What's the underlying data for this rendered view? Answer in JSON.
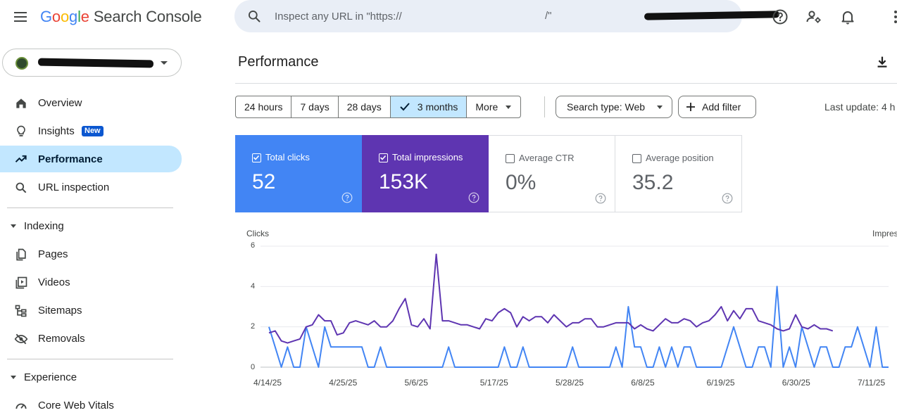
{
  "header": {
    "logo_letters": [
      "G",
      "o",
      "o",
      "g",
      "l",
      "e"
    ],
    "product": "Search Console",
    "search_placeholder": "Inspect any URL in \"https://",
    "search_suffix": "/\""
  },
  "sidebar": {
    "items": [
      {
        "label": "Overview",
        "icon": "home-icon"
      },
      {
        "label": "Insights",
        "icon": "lightbulb-icon",
        "badge": "New"
      },
      {
        "label": "Performance",
        "icon": "trending-up-icon",
        "active": true
      },
      {
        "label": "URL inspection",
        "icon": "search-icon"
      }
    ],
    "indexing": {
      "title": "Indexing",
      "items": [
        {
          "label": "Pages",
          "icon": "pages-icon"
        },
        {
          "label": "Videos",
          "icon": "video-icon"
        },
        {
          "label": "Sitemaps",
          "icon": "sitemap-icon"
        },
        {
          "label": "Removals",
          "icon": "removals-icon"
        }
      ]
    },
    "experience": {
      "title": "Experience",
      "items": [
        {
          "label": "Core Web Vitals",
          "icon": "gauge-icon"
        }
      ]
    }
  },
  "main": {
    "title": "Performance",
    "date_ranges": [
      "24 hours",
      "7 days",
      "28 days",
      "3 months",
      "More"
    ],
    "selected_range": "3 months",
    "search_type": "Search type: Web",
    "add_filter": "Add filter",
    "last_update": "Last update: 4 h",
    "metrics": [
      {
        "label": "Total clicks",
        "value": "52",
        "checked": true,
        "color": "#4285f4"
      },
      {
        "label": "Total impressions",
        "value": "153K",
        "checked": true,
        "color": "#5e35b1"
      },
      {
        "label": "Average CTR",
        "value": "0%",
        "checked": false
      },
      {
        "label": "Average position",
        "value": "35.2",
        "checked": false
      }
    ]
  },
  "chart_data": {
    "type": "line",
    "ylabel_left": "Clicks",
    "ylabel_right": "Impres",
    "yticks": [
      "6",
      "4",
      "2",
      "0"
    ],
    "ylim": [
      0,
      6
    ],
    "x_labels": [
      "4/14/25",
      "4/25/25",
      "5/6/25",
      "5/17/25",
      "5/28/25",
      "6/8/25",
      "6/19/25",
      "6/30/25",
      "7/11/25"
    ],
    "x_label_days": [
      0,
      11,
      22,
      33,
      44,
      55,
      66,
      77,
      88
    ],
    "series": [
      {
        "name": "Total clicks",
        "color": "#4285f4",
        "values": [
          2,
          1,
          0,
          1,
          0,
          0,
          2,
          1,
          0,
          2,
          1,
          1,
          1,
          1,
          1,
          1,
          0,
          0,
          1,
          0,
          0,
          0,
          0,
          0,
          0,
          0,
          0,
          0,
          0,
          1,
          0,
          0,
          0,
          0,
          0,
          0,
          0,
          0,
          1,
          0,
          0,
          1,
          0,
          0,
          0,
          0,
          0,
          0,
          0,
          1,
          0,
          0,
          0,
          0,
          0,
          0,
          1,
          0,
          3,
          1,
          1,
          0,
          0,
          1,
          0,
          1,
          0,
          1,
          1,
          0,
          0,
          0,
          0,
          0,
          1,
          2,
          1,
          0,
          0,
          1,
          1,
          0,
          4,
          0,
          1,
          0,
          2,
          1,
          0,
          1,
          1,
          0,
          0,
          1,
          1,
          2,
          1,
          0,
          2,
          0,
          0
        ]
      },
      {
        "name": "Total impressions",
        "color": "#5e35b1",
        "values": [
          1.7,
          1.8,
          1.3,
          1.2,
          1.3,
          1.4,
          2.0,
          2.1,
          2.6,
          2.3,
          2.3,
          1.6,
          1.7,
          2.2,
          2.3,
          2.2,
          2.1,
          2.3,
          2.0,
          2.0,
          2.3,
          2.9,
          3.4,
          2.1,
          2.0,
          2.4,
          1.9,
          5.6,
          2.3,
          2.3,
          2.2,
          2.1,
          2.1,
          2.0,
          1.9,
          2.4,
          2.3,
          2.7,
          2.9,
          2.7,
          2.0,
          2.5,
          2.3,
          2.5,
          2.5,
          2.2,
          2.6,
          2.3,
          2.0,
          2.2,
          2.2,
          2.4,
          2.4,
          2.0,
          2.0,
          2.1,
          2.2,
          2.2,
          2.2,
          1.9,
          2.1,
          1.9,
          1.8,
          2.1,
          2.4,
          2.2,
          2.2,
          2.4,
          2.3,
          2.0,
          2.2,
          2.3,
          2.6,
          3.0,
          2.3,
          2.8,
          2.4,
          2.9,
          2.9,
          2.3,
          2.2,
          2.1,
          1.9,
          1.8,
          1.9,
          2.6,
          2.0,
          1.9,
          2.1,
          1.9,
          1.9,
          1.8
        ]
      }
    ]
  }
}
